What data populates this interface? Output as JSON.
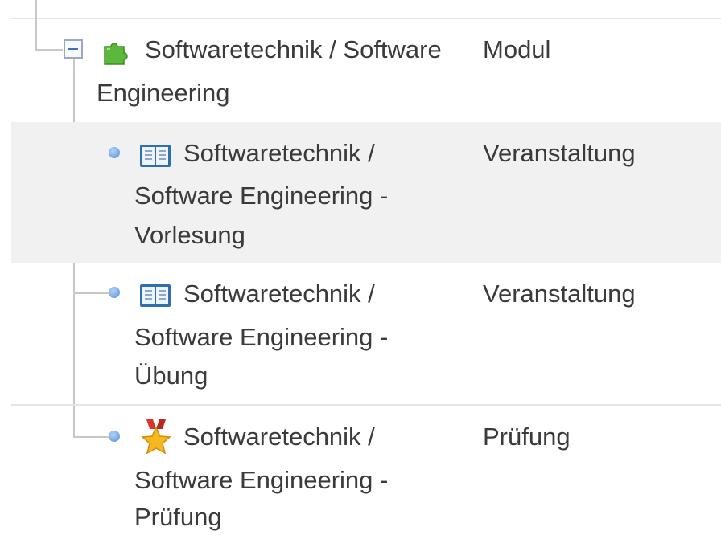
{
  "tree": {
    "module": {
      "name_line1": "Softwaretechnik / Software",
      "name_line2": "Engineering",
      "type": "Modul",
      "icon": "puzzle-icon",
      "expanded": true
    },
    "children": [
      {
        "name_lines": [
          "Softwaretechnik /",
          "Software Engineering -",
          "Vorlesung"
        ],
        "type": "Veranstaltung",
        "icon": "book-icon"
      },
      {
        "name_lines": [
          "Softwaretechnik /",
          "Software Engineering -",
          "Übung"
        ],
        "type": "Veranstaltung",
        "icon": "book-icon"
      },
      {
        "name_lines": [
          "Softwaretechnik /",
          "Software Engineering -",
          "Prüfung"
        ],
        "type": "Prüfung",
        "icon": "medal-icon"
      }
    ]
  },
  "colors": {
    "row_alt": "#f1f1f1",
    "tree_line": "#c8c8c8",
    "text": "#3a3a3a",
    "puzzle": "#5cb83a",
    "book": "#2f6fb0",
    "medal_ribbon": "#d9352a",
    "medal_star": "#f5b820"
  }
}
